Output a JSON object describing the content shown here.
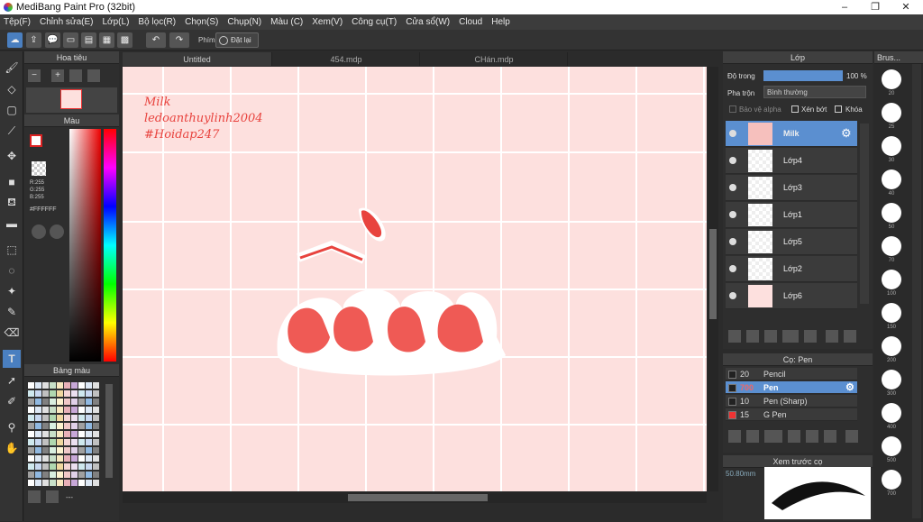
{
  "window": {
    "title": "MediBang Paint Pro (32bit)",
    "min": "–",
    "max": "❐",
    "close": "✕"
  },
  "menu": [
    "Tệp(F)",
    "Chỉnh sửa(E)",
    "Lớp(L)",
    "Bộ lọc(R)",
    "Chọn(S)",
    "Chụp(N)",
    "Màu (C)",
    "Xem(V)",
    "Công cụ(T)",
    "Cửa sổ(W)",
    "Cloud",
    "Help"
  ],
  "toolbar": {
    "phim_label": "Phím",
    "reset_label": "Đặt lại"
  },
  "navigator": {
    "title": "Hoa tiêu"
  },
  "color": {
    "title": "Màu",
    "r": "R:255",
    "g": "G:255",
    "b": "B:255",
    "hex": "#FFFFFF"
  },
  "palette": {
    "title": "Bảng màu",
    "footer": "---"
  },
  "tabs": [
    "Untitled",
    "454.mdp",
    "CHán.mdp"
  ],
  "canvas": {
    "line1": "Milk",
    "line2": "ledoanthuylinh2004",
    "line3": "#Hoidap247"
  },
  "layers": {
    "title": "Lớp",
    "opacity_label": "Độ trong",
    "opacity_value": "100 %",
    "blend_label": "Pha trộn",
    "blend_value": "Bình thường",
    "protect_alpha": "Bảo vệ alpha",
    "clip": "Xén bớt",
    "lock": "Khóa",
    "items": [
      {
        "name": "Milk"
      },
      {
        "name": "Lớp4"
      },
      {
        "name": "Lớp3"
      },
      {
        "name": "Lớp1"
      },
      {
        "name": "Lớp5"
      },
      {
        "name": "Lớp2"
      },
      {
        "name": "Lớp6"
      }
    ]
  },
  "brush": {
    "title": "Cọ: Pen",
    "items": [
      {
        "size": "20",
        "name": "Pencil"
      },
      {
        "size": "700",
        "name": "Pen"
      },
      {
        "size": "10",
        "name": "Pen (Sharp)"
      },
      {
        "size": "15",
        "name": "G Pen"
      }
    ]
  },
  "preview": {
    "title": "Xem trước cọ",
    "size": "50.80mm"
  },
  "brushsize": {
    "title": "Brus...",
    "sizes": [
      "20",
      "25",
      "30",
      "40",
      "50",
      "70",
      "100",
      "150",
      "200",
      "300",
      "400",
      "500",
      "700"
    ]
  },
  "colors": {
    "accent": "#5b8fd0",
    "canvas_bg": "#fde0de",
    "ink": "#e8433e"
  }
}
